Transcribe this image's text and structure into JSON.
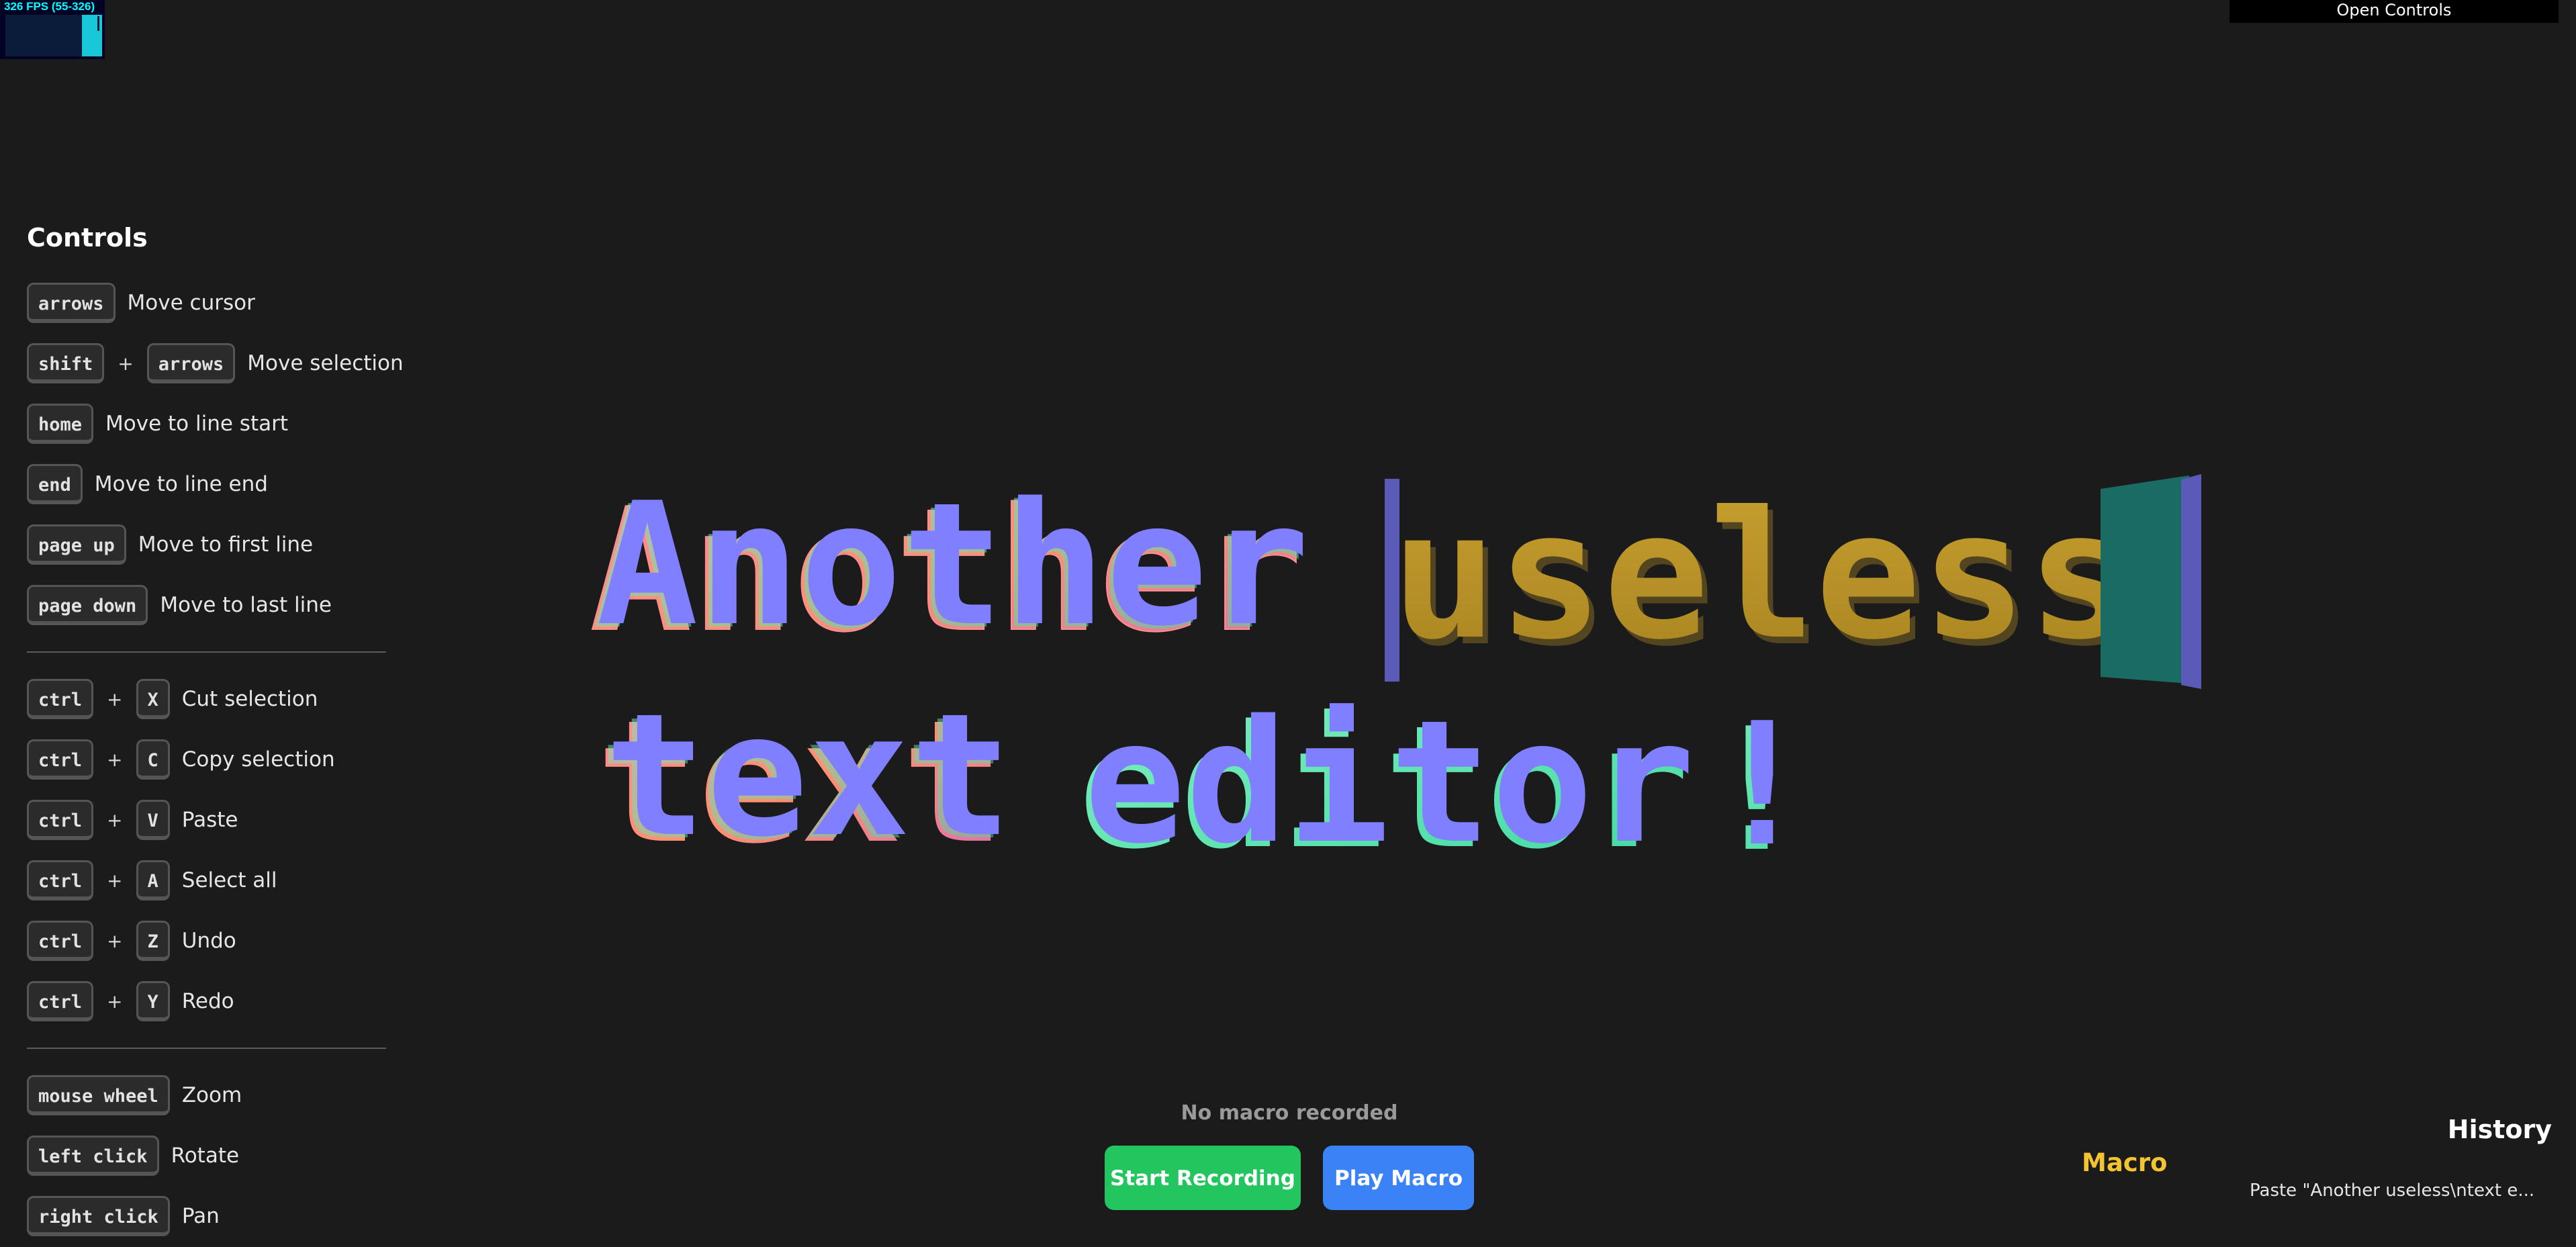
{
  "fps": {
    "label": "326 FPS (55-326)"
  },
  "open_controls_label": "Open Controls",
  "controls": {
    "title": "Controls",
    "navigation": [
      {
        "keys": [
          "arrows"
        ],
        "desc": "Move cursor"
      },
      {
        "keys": [
          "shift",
          "arrows"
        ],
        "desc": "Move selection"
      },
      {
        "keys": [
          "home"
        ],
        "desc": "Move to line start"
      },
      {
        "keys": [
          "end"
        ],
        "desc": "Move to line end"
      },
      {
        "keys": [
          "page up"
        ],
        "desc": "Move to first line"
      },
      {
        "keys": [
          "page down"
        ],
        "desc": "Move to last line"
      }
    ],
    "editing": [
      {
        "keys": [
          "ctrl",
          "X"
        ],
        "desc": "Cut selection"
      },
      {
        "keys": [
          "ctrl",
          "C"
        ],
        "desc": "Copy selection"
      },
      {
        "keys": [
          "ctrl",
          "V"
        ],
        "desc": "Paste"
      },
      {
        "keys": [
          "ctrl",
          "A"
        ],
        "desc": "Select all"
      },
      {
        "keys": [
          "ctrl",
          "Z"
        ],
        "desc": "Undo"
      },
      {
        "keys": [
          "ctrl",
          "Y"
        ],
        "desc": "Redo"
      }
    ],
    "camera": [
      {
        "keys": [
          "mouse wheel"
        ],
        "desc": "Zoom"
      },
      {
        "keys": [
          "left click"
        ],
        "desc": "Rotate"
      },
      {
        "keys": [
          "right click"
        ],
        "desc": "Pan"
      }
    ],
    "plus_sign": "+"
  },
  "editor": {
    "line1_a": "Another",
    "line1_b": "useless",
    "line2_a": "text",
    "line2_b": "editor",
    "line2_c": "!"
  },
  "macro": {
    "status": "No macro recorded",
    "record_label": "Start Recording",
    "play_label": "Play Macro",
    "title": "Macro"
  },
  "history": {
    "title": "History",
    "items": [
      "Paste \"Another useless\\ntext e..."
    ]
  },
  "colors": {
    "background": "#1b1b1b",
    "record_button": "#22c55e",
    "play_button": "#3b82f6",
    "macro_title": "#f4c430",
    "selection_text": "#d4a62a",
    "cursor": "#5a5ab8",
    "normal_face": "#7f7fff"
  }
}
